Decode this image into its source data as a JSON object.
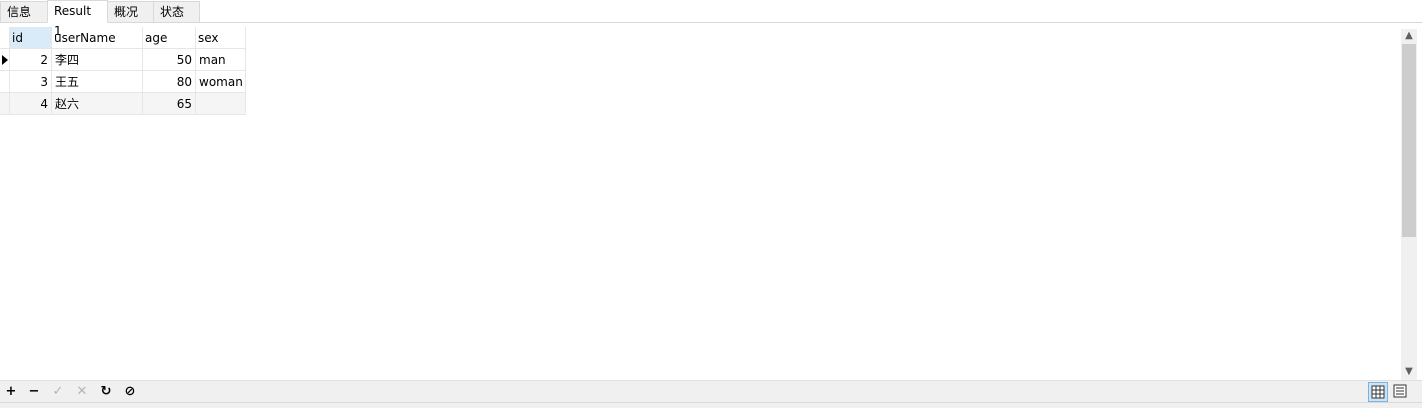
{
  "tabs": [
    {
      "label": "信息"
    },
    {
      "label": "Result 1"
    },
    {
      "label": "概况"
    },
    {
      "label": "状态"
    }
  ],
  "table": {
    "columns": [
      "id",
      "userName",
      "age",
      "sex"
    ],
    "rows": [
      {
        "id": "2",
        "userName": "李四",
        "age": "50",
        "sex": "man"
      },
      {
        "id": "3",
        "userName": "王五",
        "age": "80",
        "sex": "woman"
      },
      {
        "id": "4",
        "userName": "赵六",
        "age": "65",
        "sex": ""
      }
    ]
  },
  "toolbar": {
    "add": "+",
    "remove": "−",
    "apply": "✓",
    "discard": "✕",
    "refresh": "↻",
    "stop": "⊘"
  },
  "scroll": {
    "up": "▲",
    "down": "▼"
  }
}
